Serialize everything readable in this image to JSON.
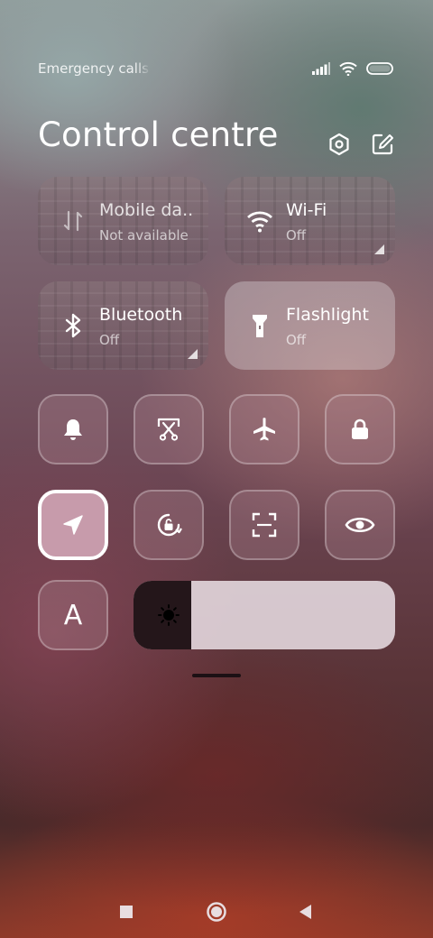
{
  "status_bar": {
    "carrier_text": "Emergency calls o",
    "icons": [
      "signal-icon",
      "wifi-icon",
      "battery-icon"
    ]
  },
  "header": {
    "title": "Control centre",
    "icons": [
      "settings-icon",
      "edit-icon"
    ]
  },
  "tiles": [
    {
      "label": "Mobile da..",
      "status": "Not available",
      "icon": "mobile-data-icon",
      "active": false,
      "has_corner": false
    },
    {
      "label": "Wi-Fi",
      "status": "Off",
      "icon": "wifi-icon",
      "active": false,
      "has_corner": true
    },
    {
      "label": "Bluetooth",
      "status": "Off",
      "icon": "bluetooth-icon",
      "active": false,
      "has_corner": true
    },
    {
      "label": "Flashlight",
      "status": "Off",
      "icon": "flashlight-icon",
      "active": true,
      "has_corner": false
    }
  ],
  "toggles_row1": [
    "bell-icon",
    "screenshot-icon",
    "airplane-icon",
    "lock-icon"
  ],
  "toggles_row2": [
    {
      "icon": "location-icon",
      "active": true
    },
    {
      "icon": "rotation-lock-icon",
      "active": false
    },
    {
      "icon": "scanner-icon",
      "active": false
    },
    {
      "icon": "eye-icon",
      "active": false
    }
  ],
  "font_toggle": {
    "icon": "font-icon",
    "glyph": "A"
  },
  "brightness": {
    "level": 0.22,
    "icon": "brightness-icon"
  },
  "navbar": [
    "recents-button",
    "home-button",
    "back-button"
  ],
  "colors": {
    "active_toggle": "#c79bab",
    "brightness_track": "#ebe1e6",
    "brightness_fill": "#24161a"
  }
}
